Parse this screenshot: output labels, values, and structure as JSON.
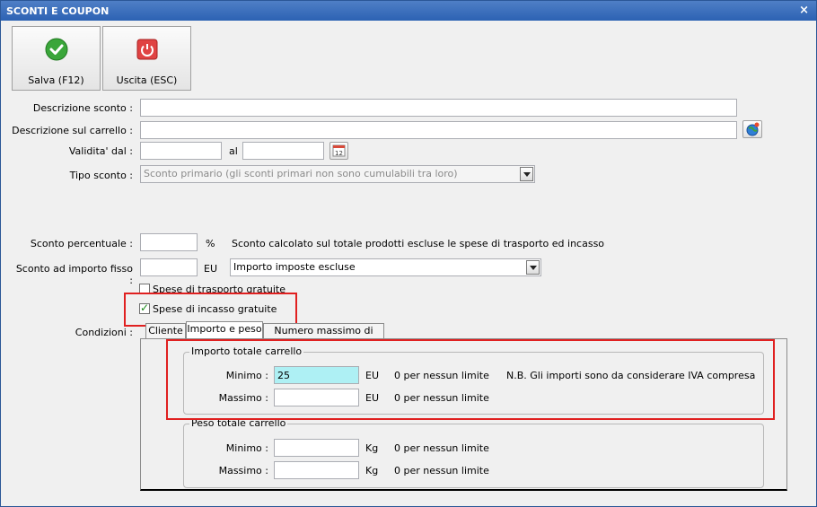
{
  "window": {
    "title": "SCONTI E COUPON",
    "close": "×"
  },
  "toolbar": {
    "save_label": "Salva (F12)",
    "exit_label": "Uscita (ESC)"
  },
  "form": {
    "descrizione_label": "Descrizione sconto :",
    "descrizione_value": "",
    "carrello_label": "Descrizione sul carrello :",
    "carrello_value": "",
    "validita_label": "Validita' dal :",
    "validita_dal": "",
    "al_label": "al",
    "validita_al": "",
    "tipo_label": "Tipo sconto :",
    "tipo_value": "Sconto primario (gli sconti primari non sono cumulabili tra loro)",
    "percentuale_label": "Sconto percentuale :",
    "percentuale_value": "",
    "percent_unit": "%",
    "percent_note": "Sconto calcolato sul totale prodotti escluse le spese di trasporto ed incasso",
    "importo_label": "Sconto ad importo fisso :",
    "importo_value": "",
    "eu_unit": "EU",
    "importo_select": "Importo imposte escluse",
    "trasporto_label": "Spese di trasporto gratuite",
    "trasporto_checked": false,
    "incasso_label": "Spese di incasso gratuite",
    "incasso_checked": true,
    "condizioni_label": "Condizioni :"
  },
  "tabs": [
    "Cliente",
    "Importo e peso",
    "Numero massimo di utilizzi"
  ],
  "importo_group": {
    "title": "Importo totale carrello",
    "minimo_label": "Minimo :",
    "minimo_value": "25",
    "massimo_label": "Massimo :",
    "massimo_value": "",
    "unit": "EU",
    "hint": "0 per nessun limite",
    "note": "N.B. Gli importi sono da considerare IVA compresa"
  },
  "peso_group": {
    "title": "Peso totale carrello",
    "minimo_label": "Minimo :",
    "minimo_value": "",
    "massimo_label": "Massimo :",
    "massimo_value": "",
    "unit": "Kg",
    "hint": "0 per nessun limite"
  },
  "colors": {
    "title_bar": "#2c62b3",
    "highlight": "#e02020",
    "active_input": "#aef0f4"
  },
  "icons": [
    "checkmark-icon",
    "power-icon",
    "globe-icon",
    "calendar-icon",
    "chevron-down-icon"
  ]
}
